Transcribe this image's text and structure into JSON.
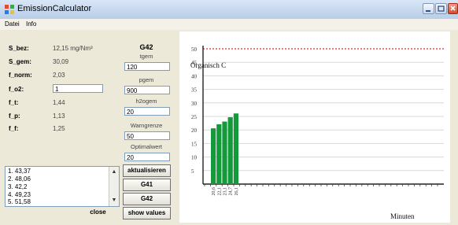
{
  "window": {
    "title": "EmissionCalculator"
  },
  "menu": [
    "Datei",
    "Info"
  ],
  "params": [
    {
      "label": "S_bez:",
      "value": "12,15 mg/Nm³"
    },
    {
      "label": "S_gem:",
      "value": "30,09"
    },
    {
      "label": "f_norm:",
      "value": "2,03"
    },
    {
      "label": "f_o2:",
      "input": "1"
    },
    {
      "label": "f_t:",
      "value": "1,44"
    },
    {
      "label": "f_p:",
      "value": "1,13"
    },
    {
      "label": "f_f:",
      "value": "1,25"
    }
  ],
  "settings": {
    "title": "G42",
    "fields": [
      {
        "label": "tgem",
        "value": "120"
      },
      {
        "label": "pgem",
        "value": "900"
      },
      {
        "label": "h2ogem",
        "value": "20"
      },
      {
        "label": "Warngrenze",
        "value": "50"
      },
      {
        "label": "Optimalwert",
        "value": "20"
      }
    ]
  },
  "buttons": {
    "update": "aktualisieren",
    "g41": "G41",
    "g42": "G42",
    "show": "show values",
    "close": "close"
  },
  "list": [
    "1. 43,37",
    "2. 48,06",
    "3. 42,2",
    "4. 49,23",
    "5. 51,58"
  ],
  "scroll_icons": {
    "up": "chevron-up-icon",
    "down": "chevron-down-icon"
  },
  "chart_data": {
    "type": "bar",
    "title": "Organisch C",
    "xlabel": "Minuten",
    "ylim": [
      0,
      50
    ],
    "yticks": [
      5,
      10,
      15,
      20,
      25,
      30,
      35,
      40,
      45,
      50
    ],
    "categories": [
      "20,6",
      "22,1",
      "23,1",
      "24,7",
      "26,1"
    ],
    "values": [
      20.6,
      22.1,
      23.1,
      24.7,
      26.1
    ],
    "threshold": 50,
    "colors": {
      "bar": "#149a3a",
      "threshold": "#e23030",
      "grid": "#d8d8d8"
    }
  }
}
